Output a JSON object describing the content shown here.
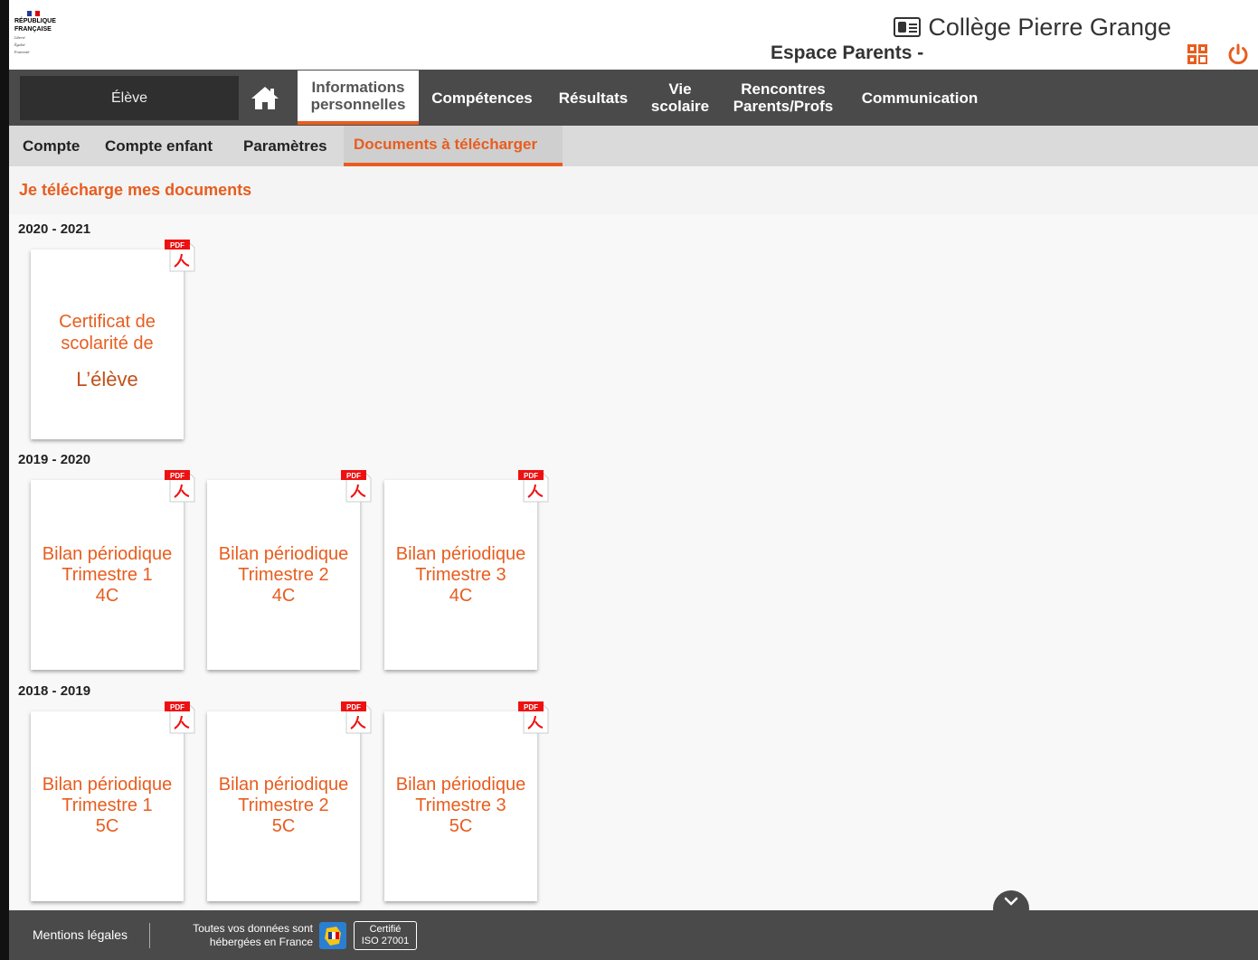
{
  "header": {
    "rf_logo": {
      "line1": "RÉPUBLIQUE",
      "line2": "FRANÇAISE",
      "motto": [
        "Liberté",
        "Égalité",
        "Fraternité"
      ]
    },
    "school_name": "Collège Pierre Grange",
    "space_label": "Espace Parents -",
    "qr_icon": "qr-code-icon",
    "power_icon": "power-icon"
  },
  "nav": {
    "student_selector": "Élève",
    "home_icon": "home-icon",
    "items": [
      {
        "line1": "Informations",
        "line2": "personnelles"
      },
      {
        "line1": "Compétences",
        "line2": ""
      },
      {
        "line1": "Résultats",
        "line2": ""
      },
      {
        "line1": "Vie",
        "line2": "scolaire"
      },
      {
        "line1": "Rencontres",
        "line2": "Parents/Profs"
      },
      {
        "line1": "Communication",
        "line2": ""
      }
    ],
    "active_index": 0
  },
  "subnav": {
    "items": [
      "Compte",
      "Compte enfant",
      "Paramètres",
      "Documents à télécharger"
    ],
    "active_index": 3
  },
  "section_title": "Je télécharge mes documents",
  "years": [
    {
      "label": "2020 - 2021",
      "documents": [
        {
          "lines": [
            "Certificat de",
            "scolarité de"
          ],
          "name": "L’élève",
          "badge": "PDF"
        }
      ]
    },
    {
      "label": "2019 - 2020",
      "documents": [
        {
          "lines": [
            "Bilan périodique",
            "Trimestre 1",
            "4C"
          ],
          "badge": "PDF"
        },
        {
          "lines": [
            "Bilan périodique",
            "Trimestre 2",
            "4C"
          ],
          "badge": "PDF"
        },
        {
          "lines": [
            "Bilan périodique",
            "Trimestre 3",
            "4C"
          ],
          "badge": "PDF"
        }
      ]
    },
    {
      "label": "2018 - 2019",
      "documents": [
        {
          "lines": [
            "Bilan périodique",
            "Trimestre 1",
            "5C"
          ],
          "badge": "PDF"
        },
        {
          "lines": [
            "Bilan périodique",
            "Trimestre 2",
            "5C"
          ],
          "badge": "PDF"
        },
        {
          "lines": [
            "Bilan périodique",
            "Trimestre 3",
            "5C"
          ],
          "badge": "PDF"
        }
      ]
    }
  ],
  "footer": {
    "mentions": "Mentions légales",
    "hosting_line1": "Toutes vos données sont",
    "hosting_line2": "hébergées en France",
    "iso_line1": "Certifié",
    "iso_line2": "ISO 27001",
    "scroll_icon": "chevron-down-icon"
  },
  "colors": {
    "accent": "#e85d1f",
    "nav_bg": "#4a4a4a",
    "subnav_bg": "#dadada"
  }
}
